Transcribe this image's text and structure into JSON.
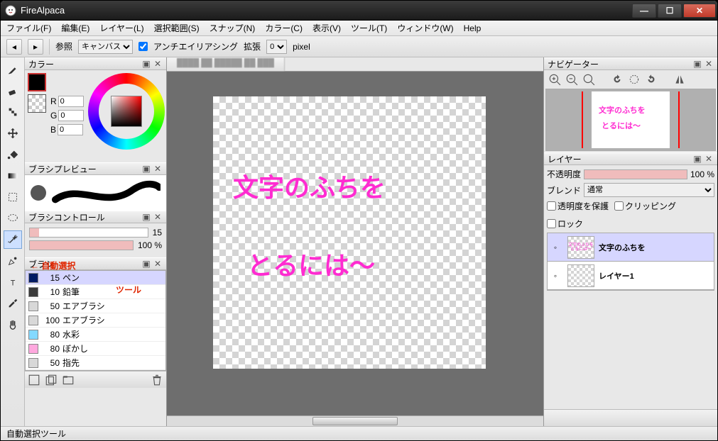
{
  "app": {
    "title": "FireAlpaca"
  },
  "window_buttons": {
    "min": "—",
    "max": "☐",
    "close": "✕"
  },
  "menu": {
    "file": "ファイル(F)",
    "edit": "編集(E)",
    "layer": "レイヤー(L)",
    "select": "選択範囲(S)",
    "snap": "スナップ(N)",
    "color": "カラー(C)",
    "view": "表示(V)",
    "tool": "ツール(T)",
    "window": "ウィンドウ(W)",
    "help": "Help"
  },
  "toolbar": {
    "ref_label": "参照",
    "ref_options": [
      "キャンバス"
    ],
    "antialias": "アンチエイリアシング",
    "expand_label": "拡張",
    "expand_value": "0",
    "expand_unit": "pixel"
  },
  "panels": {
    "color": "カラー",
    "brush_preview": "ブラシプレビュー",
    "brush_control": "ブラシコントロール",
    "brush": "ブラシ",
    "navigator": "ナビゲーター",
    "layer": "レイヤー"
  },
  "color": {
    "fg": "#000000",
    "r_label": "R",
    "g_label": "G",
    "b_label": "B",
    "r": "0",
    "g": "0",
    "b": "0"
  },
  "brush_control": {
    "size": "15",
    "opacity": "100 %"
  },
  "brushes": [
    {
      "size": "15",
      "name": "ペン",
      "color": "#001b63",
      "sel": true
    },
    {
      "size": "10",
      "name": "鉛筆",
      "color": "#3a3a3a"
    },
    {
      "size": "50",
      "name": "エアブラシ",
      "color": "#d8d8d8"
    },
    {
      "size": "100",
      "name": "エアブラシ",
      "color": "#d8d8d8"
    },
    {
      "size": "80",
      "name": "水彩",
      "color": "#84d9ff"
    },
    {
      "size": "80",
      "name": "ぼかし",
      "color": "#ffa8de"
    },
    {
      "size": "50",
      "name": "指先",
      "color": "#d8d8d8"
    }
  ],
  "canvas": {
    "line1": "文字のふちを",
    "line2": "とるには～"
  },
  "annotation": {
    "line1": "← 自動選択",
    "line2": "ツール"
  },
  "layer_panel": {
    "opacity_label": "不透明度",
    "opacity_value": "100 %",
    "blend_label": "ブレンド",
    "blend_value": "通常",
    "protect_alpha": "透明度を保護",
    "clipping": "クリッピング",
    "lock": "ロック"
  },
  "layers": [
    {
      "name": "文字のふちを",
      "sel": true
    },
    {
      "name": "レイヤー1"
    }
  ],
  "status": {
    "text": "自動選択ツール"
  }
}
